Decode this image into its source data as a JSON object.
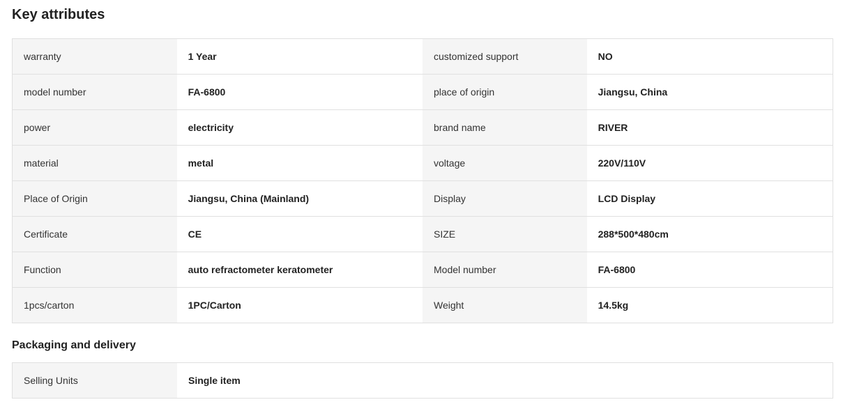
{
  "key_attributes": {
    "title": "Key attributes",
    "rows": [
      {
        "left": {
          "label": "warranty",
          "value": "1 Year"
        },
        "right": {
          "label": "customized support",
          "value": "NO"
        }
      },
      {
        "left": {
          "label": "model number",
          "value": "FA-6800"
        },
        "right": {
          "label": "place of origin",
          "value": "Jiangsu, China"
        }
      },
      {
        "left": {
          "label": "power",
          "value": "electricity"
        },
        "right": {
          "label": "brand name",
          "value": "RIVER"
        }
      },
      {
        "left": {
          "label": "material",
          "value": "metal"
        },
        "right": {
          "label": "voltage",
          "value": "220V/110V"
        }
      },
      {
        "left": {
          "label": "Place of Origin",
          "value": "Jiangsu, China (Mainland)"
        },
        "right": {
          "label": "Display",
          "value": "LCD Display"
        }
      },
      {
        "left": {
          "label": "Certificate",
          "value": "CE"
        },
        "right": {
          "label": "SIZE",
          "value": "288*500*480cm"
        }
      },
      {
        "left": {
          "label": "Function",
          "value": "auto refractometer keratometer"
        },
        "right": {
          "label": "Model number",
          "value": "FA-6800"
        }
      },
      {
        "left": {
          "label": "1pcs/carton",
          "value": "1PC/Carton"
        },
        "right": {
          "label": "Weight",
          "value": "14.5kg"
        }
      }
    ]
  },
  "packaging": {
    "title": "Packaging and delivery",
    "rows": [
      {
        "label": "Selling Units",
        "value": "Single item"
      }
    ]
  }
}
